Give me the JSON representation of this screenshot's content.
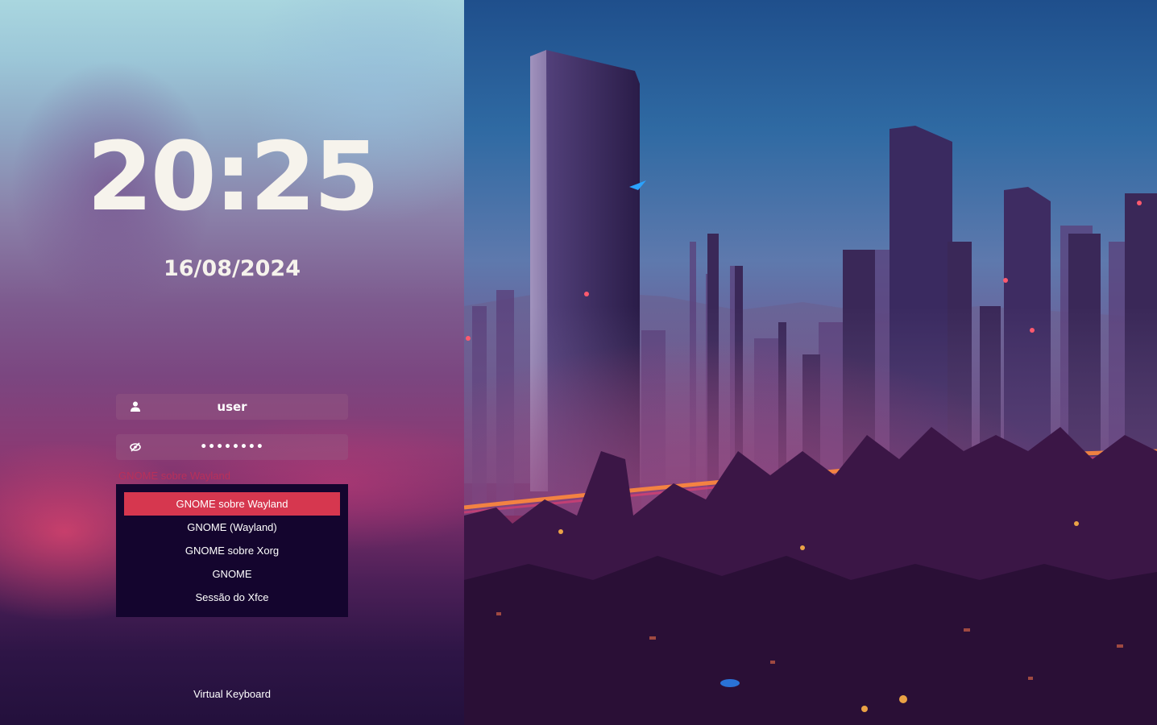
{
  "clock": {
    "time": "20:25",
    "date": "16/08/2024"
  },
  "login": {
    "username": "user",
    "password_mask": "••••••••",
    "username_icon": "user-icon",
    "password_icon": "eye-slash-icon"
  },
  "session": {
    "current_label": "GNOME sobre Wayland",
    "options": [
      "GNOME sobre Wayland",
      "GNOME (Wayland)",
      "GNOME sobre Xorg",
      "GNOME",
      "Sessão do Xfce"
    ],
    "selected_index": 0
  },
  "footer": {
    "virtual_keyboard": "Virtual Keyboard"
  },
  "colors": {
    "selection": "#d6374f",
    "menu_background": "#14052e",
    "text": "#f6f3ec",
    "session_label": "#b8305a"
  }
}
